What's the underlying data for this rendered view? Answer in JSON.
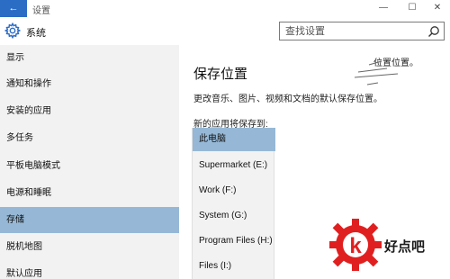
{
  "window": {
    "back_glyph": "←",
    "title": "设置",
    "minimize": "—",
    "maximize": "☐",
    "close": "✕"
  },
  "header": {
    "app_name": "系统",
    "search_placeholder": "查找设置"
  },
  "sidebar": {
    "items": [
      {
        "label": "显示",
        "active": false
      },
      {
        "label": "通知和操作",
        "active": false
      },
      {
        "label": "安装的应用",
        "active": false
      },
      {
        "label": "多任务",
        "active": false
      },
      {
        "label": "平板电脑模式",
        "active": false
      },
      {
        "label": "电源和睡眠",
        "active": false
      },
      {
        "label": "存储",
        "active": true
      },
      {
        "label": "脱机地图",
        "active": false
      },
      {
        "label": "默认应用",
        "active": false
      }
    ]
  },
  "main": {
    "title": "保存位置",
    "description": "更改音乐、图片、视频和文档的默认保存位置。",
    "dropdown_label": "新的应用将保存到:",
    "dropdown_options": [
      {
        "label": "此电脑",
        "selected": true
      },
      {
        "label": "Supermarket (E:)",
        "selected": false
      },
      {
        "label": "Work (F:)",
        "selected": false
      },
      {
        "label": "System (G:)",
        "selected": false
      },
      {
        "label": "Program Files (H:)",
        "selected": false
      },
      {
        "label": "Files (I:)",
        "selected": false
      }
    ],
    "peek_text": "位置位置。"
  },
  "watermark": {
    "text": "好点吧",
    "logo_letter": "k"
  },
  "colors": {
    "accent": "#2b6cc4",
    "selection": "#96b8d6",
    "sidebar_bg": "#f2f2f2",
    "logo_red": "#e02020"
  }
}
